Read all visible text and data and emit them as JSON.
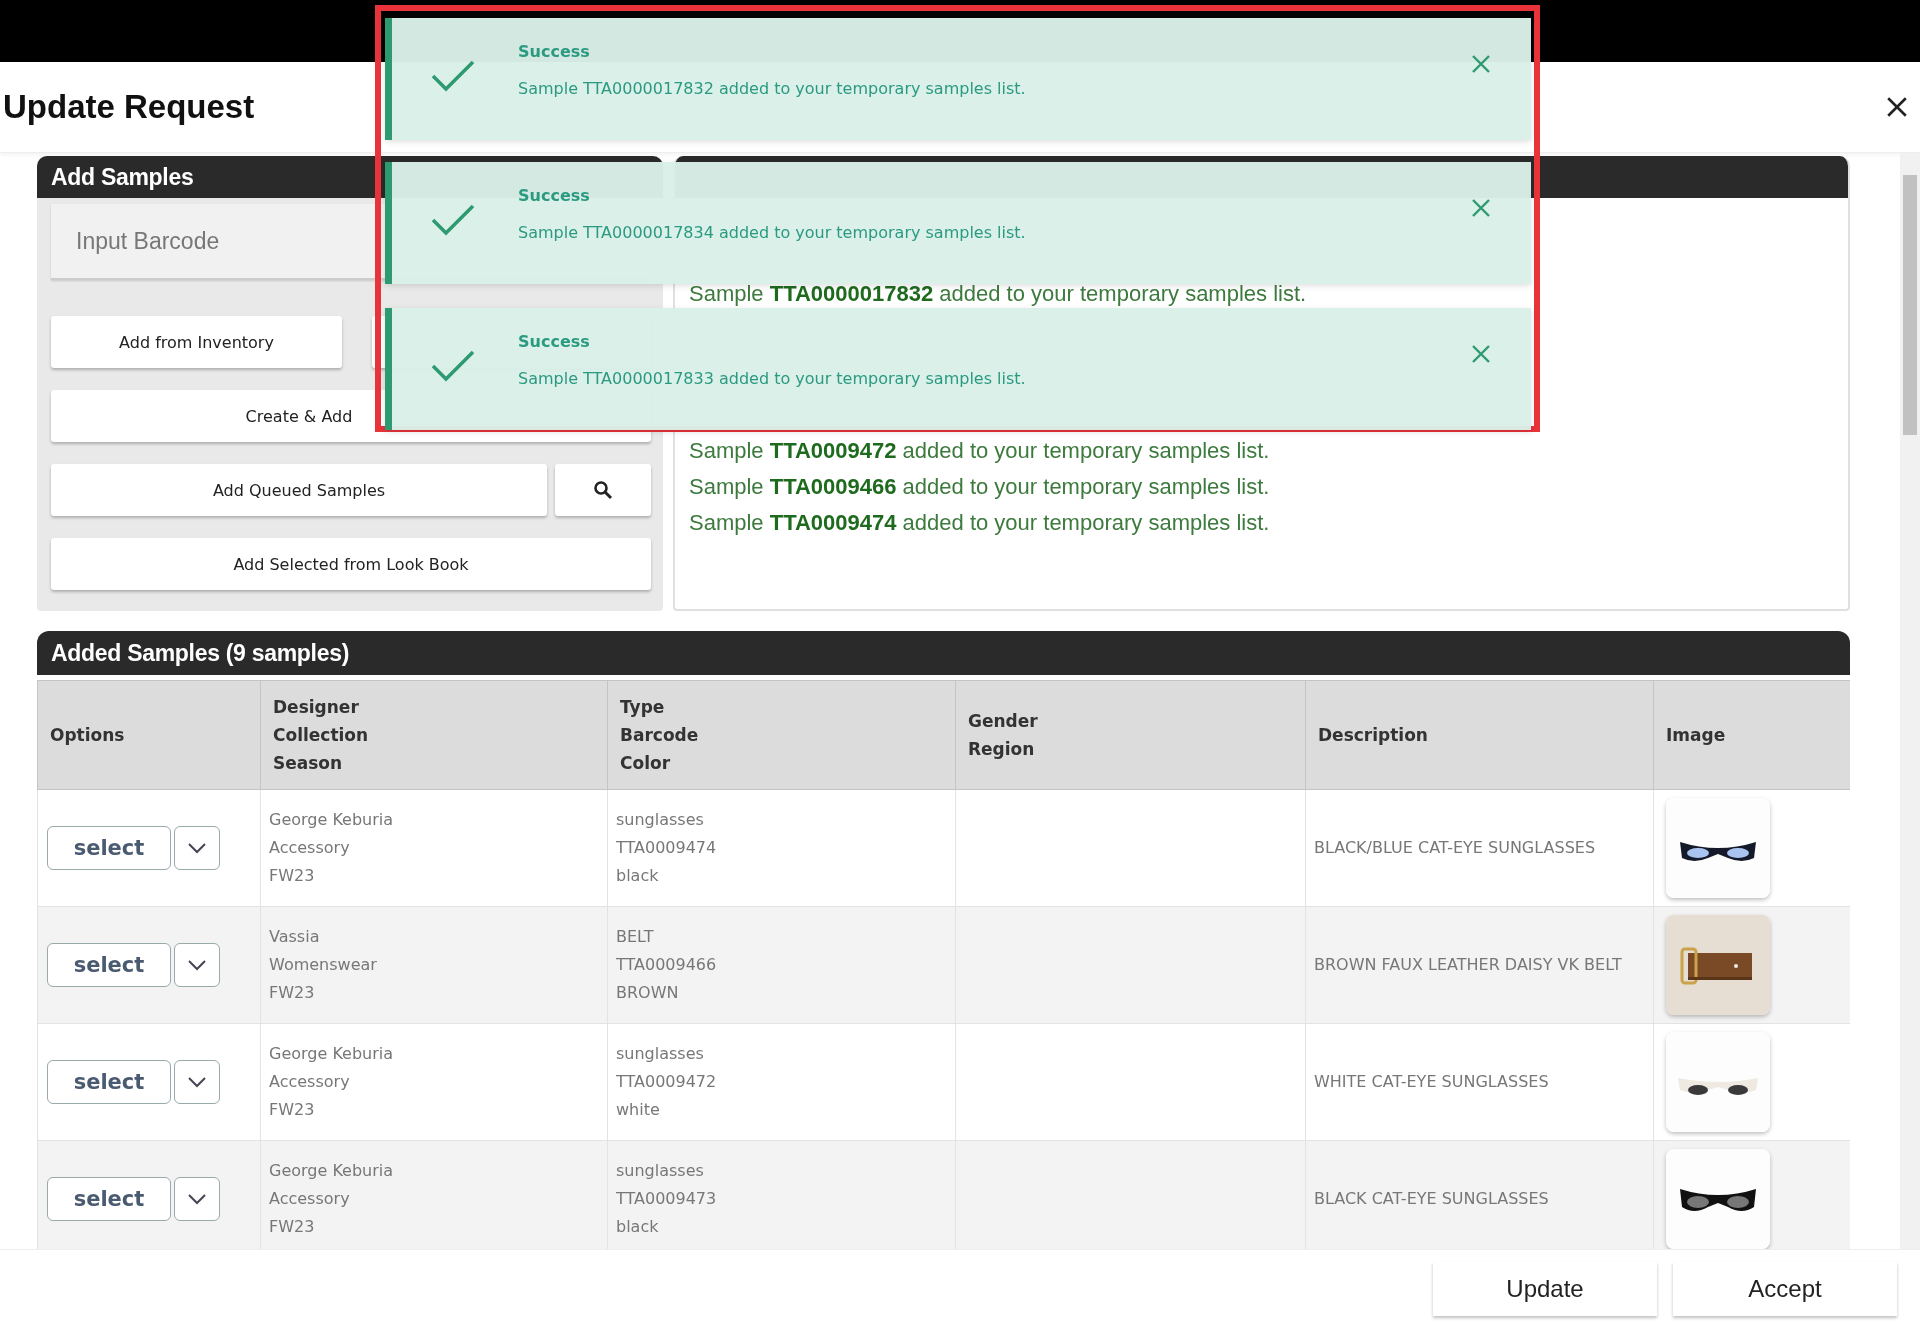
{
  "window": {
    "title": "Update Request"
  },
  "add_samples": {
    "title": "Add Samples",
    "barcode_field": {
      "placeholder": "Input Barcode"
    },
    "button_rows": [
      [
        {
          "kind": "text",
          "label": "Add from Inventory"
        },
        {
          "kind": "blank"
        }
      ],
      [
        {
          "kind": "text",
          "label": "Create & Add"
        }
      ],
      [
        {
          "kind": "text",
          "label": "Add Queued Samples"
        },
        {
          "kind": "search"
        }
      ],
      [
        {
          "kind": "text",
          "label": "Add Selected from Look Book"
        }
      ]
    ]
  },
  "logs": {
    "lines": [
      "Sample **TTA0000017832** added to your temporary samples list.",
      "Sample **TTA0009472** added to your temporary samples list.",
      "Sample **TTA0009466** added to your temporary samples list.",
      "Sample **TTA0009474** added to your temporary samples list."
    ]
  },
  "added_samples": {
    "title": "Added Samples (9 samples)",
    "columns": [
      {
        "lines": [
          "Options"
        ]
      },
      {
        "lines": [
          "Designer",
          "Collection",
          "Season"
        ]
      },
      {
        "lines": [
          "Type",
          "Barcode",
          "Color"
        ]
      },
      {
        "lines": [
          "Gender",
          "Region"
        ]
      },
      {
        "lines": [
          "Description"
        ]
      },
      {
        "lines": [
          "Image"
        ]
      }
    ],
    "rows": [
      {
        "select": "select",
        "designer": [
          "George Keburia",
          "Accessory",
          "FW23"
        ],
        "type": [
          "sunglasses",
          "TTA0009474",
          "black"
        ],
        "description": "BLACK/BLUE CAT-EYE SUNGLASSES",
        "image": {
          "kind": "picture"
        }
      },
      {
        "select": "select",
        "designer": [
          "Vassia",
          "Womenswear",
          "FW23"
        ],
        "type": [
          "BELT",
          "TTA0009466",
          "BROWN"
        ],
        "description": "BROWN FAUX LEATHER DAISY VK BELT",
        "image": {
          "kind": "picture"
        }
      },
      {
        "select": "select",
        "designer": [
          "George Keburia",
          "Accessory",
          "FW23"
        ],
        "type": [
          "sunglasses",
          "TTA0009472",
          "white"
        ],
        "description": "WHITE CAT-EYE SUNGLASSES",
        "image": {
          "kind": "picture"
        }
      },
      {
        "select": "select",
        "designer": [
          "George Keburia",
          "Accessory",
          "FW23"
        ],
        "type": [
          "sunglasses",
          "TTA0009473",
          "black"
        ],
        "description": "BLACK CAT-EYE SUNGLASSES",
        "image": {
          "kind": "picture"
        }
      }
    ]
  },
  "footer": {
    "buttons": [
      "Update",
      "Accept"
    ]
  },
  "toasts": [
    {
      "title": "Success",
      "message": "Sample TTA0000017832 added to your temporary samples list."
    },
    {
      "title": "Success",
      "message": "Sample TTA0000017834 added to your temporary samples list."
    },
    {
      "title": "Success",
      "message": "Sample TTA0000017833 added to your temporary samples list."
    }
  ]
}
